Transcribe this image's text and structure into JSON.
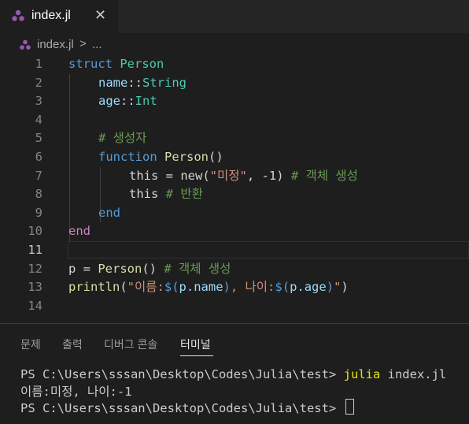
{
  "tab": {
    "label": "index.jl",
    "close": "✕",
    "icon": "julia-file-icon"
  },
  "breadcrumb": {
    "file": "index.jl",
    "separator": ">",
    "more": "..."
  },
  "editor": {
    "line_numbers": [
      "1",
      "2",
      "3",
      "4",
      "5",
      "6",
      "7",
      "8",
      "9",
      "10",
      "11",
      "12",
      "13",
      "14"
    ],
    "active_line": "11",
    "lines": {
      "l1_kw": "struct",
      "l1_name": " Person",
      "l2_field": "name",
      "l2_sep": "::",
      "l2_type": "String",
      "l3_field": "age",
      "l3_sep": "::",
      "l3_type": "Int",
      "l5_comment": "# 생성자",
      "l6_kw": "function",
      "l6_fn": " Person",
      "l6_paren": "()",
      "l7_this": "this",
      "l7_eq": " = ",
      "l7_fn": "new",
      "l7_open": "(",
      "l7_str": "\"미정\"",
      "l7_comma": ", ",
      "l7_num": "-1",
      "l7_close": ") ",
      "l7_comment": "# 객체 생성",
      "l8_this": "this",
      "l8_comment": " # 반환",
      "l9_kw": "end",
      "l10_kw": "end",
      "l12_var": "p",
      "l12_eq": " = ",
      "l12_fn": "Person",
      "l12_paren": "() ",
      "l12_comment": "# 객체 생성",
      "l13_fn": "println",
      "l13_open": "(",
      "l13_s1": "\"이름:",
      "l13_i1a": "$(",
      "l13_i1b": "p.name",
      "l13_i1c": ")",
      "l13_s2": ", 나이:",
      "l13_i2a": "$(",
      "l13_i2b": "p.age",
      "l13_i2c": ")",
      "l13_s3": "\"",
      "l13_close": ")"
    }
  },
  "panel": {
    "tabs": [
      "문제",
      "출력",
      "디버그 콘솔",
      "터미널"
    ],
    "active_tab": "터미널",
    "terminal": {
      "line1_prompt": "PS C:\\Users\\sssan\\Desktop\\Codes\\Julia\\test> ",
      "line1_cmd": "julia",
      "line1_arg": " index.jl",
      "line2": "이름:미정, 나이:-1",
      "line3_prompt": "PS C:\\Users\\sssan\\Desktop\\Codes\\Julia\\test> "
    }
  }
}
